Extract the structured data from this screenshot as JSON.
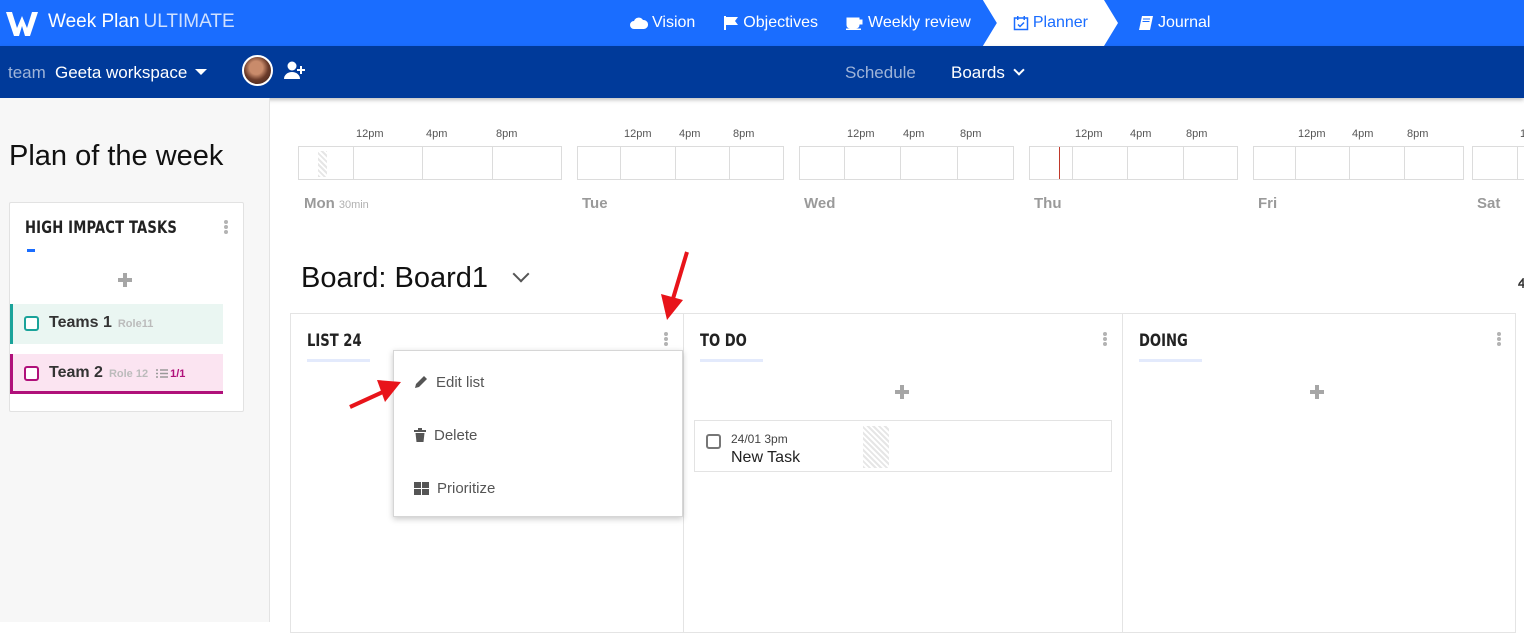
{
  "app": {
    "name": "Week Plan",
    "edition": "ULTIMATE"
  },
  "topnav": [
    {
      "label": "Vision",
      "icon": "cloud-icon"
    },
    {
      "label": "Objectives",
      "icon": "flag-icon"
    },
    {
      "label": "Weekly review",
      "icon": "coffee-icon"
    },
    {
      "label": "Planner",
      "icon": "calendar-check-icon",
      "active": true
    },
    {
      "label": "Journal",
      "icon": "book-icon"
    }
  ],
  "subnav": {
    "team_label": "team",
    "team_name": "Geeta workspace",
    "schedule": "Schedule",
    "boards": "Boards"
  },
  "left": {
    "title": "Plan of the week",
    "hit_title": "HIGH IMPACT TASKS",
    "tasks": [
      {
        "name": "Teams 1",
        "role": "Role11",
        "count": "",
        "color": "#1aa39a"
      },
      {
        "name": "Team 2",
        "role": "Role 12",
        "count": "1/1",
        "color": "#b0107a"
      }
    ]
  },
  "week": {
    "hours": [
      "12pm",
      "4pm",
      "8pm"
    ],
    "days": [
      {
        "name": "Mon",
        "duration": "30min"
      },
      {
        "name": "Tue",
        "duration": ""
      },
      {
        "name": "Wed",
        "duration": ""
      },
      {
        "name": "Thu",
        "duration": ""
      },
      {
        "name": "Fri",
        "duration": ""
      },
      {
        "name": "Sat",
        "duration": ""
      }
    ]
  },
  "board": {
    "title": "Board: Board1",
    "lists": [
      {
        "title": "LIST 24"
      },
      {
        "title": "TO DO"
      },
      {
        "title": "DOING"
      }
    ],
    "card": {
      "date": "24/01 3pm",
      "name": "New Task"
    }
  },
  "menu": {
    "items": [
      "Edit list",
      "Delete",
      "Prioritize"
    ]
  },
  "colors": {
    "primary": "#1a6dff",
    "subnav": "#003a9a",
    "annotation": "#e8141a",
    "now_line": "#c0392b"
  }
}
